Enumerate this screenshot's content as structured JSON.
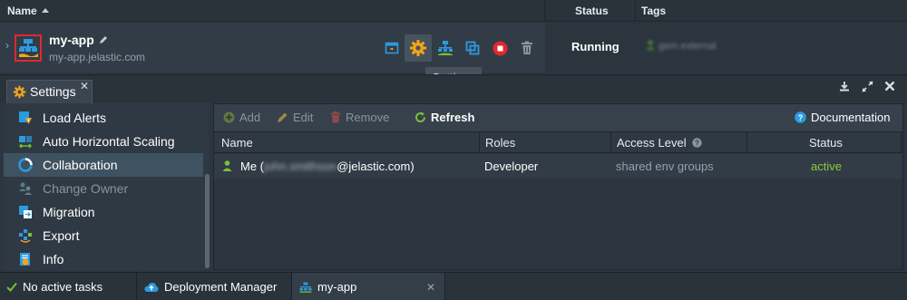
{
  "env_header": {
    "name_label": "Name",
    "status_label": "Status",
    "tags_label": "Tags"
  },
  "environment": {
    "name": "my-app",
    "url": "my-app.jelastic.com",
    "status": "Running",
    "tag": "gem.external"
  },
  "tooltip": "Settings",
  "settings_tab": {
    "label": "Settings",
    "close": "✕"
  },
  "menu": {
    "items": [
      {
        "label": "Load Alerts",
        "icon": "load-alerts-icon"
      },
      {
        "label": "Auto Horizontal Scaling",
        "icon": "scaling-icon"
      },
      {
        "label": "Collaboration",
        "icon": "collaboration-icon",
        "selected": true
      },
      {
        "label": "Change Owner",
        "icon": "change-owner-icon",
        "disabled": true
      },
      {
        "label": "Migration",
        "icon": "migration-icon"
      },
      {
        "label": "Export",
        "icon": "export-icon"
      },
      {
        "label": "Info",
        "icon": "info-icon"
      }
    ]
  },
  "toolbar": {
    "add_label": "Add",
    "edit_label": "Edit",
    "remove_label": "Remove",
    "refresh_label": "Refresh",
    "documentation_label": "Documentation"
  },
  "grid": {
    "columns": [
      "Name",
      "Roles",
      "Access Level",
      "Status"
    ],
    "rows": [
      {
        "name_prefix": "Me (",
        "name_hidden": "john.smithson",
        "name_suffix": "@jelastic.com)",
        "role": "Developer",
        "access": "shared env groups",
        "status": "active"
      }
    ]
  },
  "bottom_bar": {
    "tasks_label": "No active tasks",
    "deployment_label": "Deployment Manager",
    "env_tab_label": "my-app"
  },
  "colors": {
    "accent_green": "#7bbf3a",
    "status_active": "#8ccb3c",
    "access_link": "#8fa3b0",
    "highlight_red": "#e0282e",
    "gear_orange": "#f2a51a",
    "blue": "#2b9be0"
  }
}
